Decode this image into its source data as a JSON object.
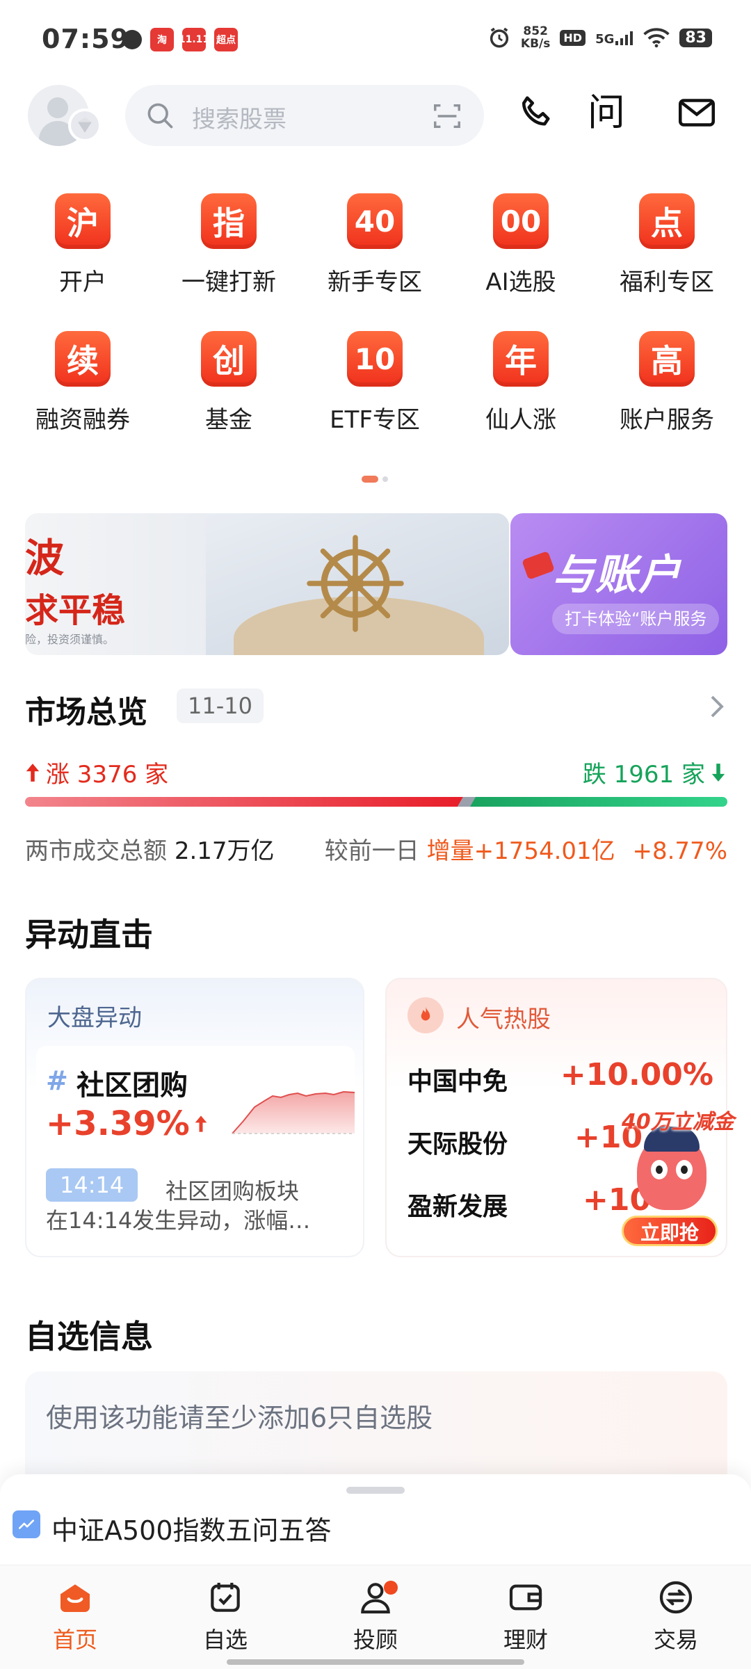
{
  "status_bar": {
    "time": "07:59",
    "apps": [
      "淘",
      "11.11",
      "超点"
    ],
    "net_speed_value": "852",
    "net_speed_unit": "KB/s",
    "hd": "HD",
    "signal": "5G",
    "battery": "83"
  },
  "header": {
    "search_placeholder": "搜索股票",
    "icons": [
      "phone-icon",
      "wen-icon",
      "mail-icon"
    ],
    "wen_glyph": "问"
  },
  "grid": [
    {
      "glyph": "沪",
      "label": "开户"
    },
    {
      "glyph": "指",
      "label": "一键打新"
    },
    {
      "glyph": "40",
      "label": "新手专区"
    },
    {
      "glyph": "00",
      "label": "AI选股"
    },
    {
      "glyph": "点",
      "label": "福利专区"
    },
    {
      "glyph": "续",
      "label": "融资融券"
    },
    {
      "glyph": "创",
      "label": "基金"
    },
    {
      "glyph": "10",
      "label": "ETF专区"
    },
    {
      "glyph": "年",
      "label": "仙人涨"
    },
    {
      "glyph": "高",
      "label": "账户服务"
    }
  ],
  "banners": {
    "b1_line1": "波",
    "b1_line2": "求平稳",
    "b1_line3": "险，投资须谨慎。",
    "b2_title": "与账户",
    "b2_sub": "打卡体验“账户服务"
  },
  "market": {
    "title": "市场总览",
    "date": "11-10",
    "up_label": "涨 3376 家",
    "down_label": "跌 1961 家",
    "up_count": 3376,
    "down_count": 1961,
    "turnover_label": "两市成交总额",
    "turnover_value": "2.17万亿",
    "compare_label": "较前一日",
    "compare_value": "增量+1754.01亿",
    "compare_pct": "+8.77%"
  },
  "anomaly": {
    "title": "异动直击",
    "left_card": {
      "title": "大盘异动",
      "hash": "#",
      "sector": "社区团购",
      "pct": "+3.39%",
      "time": "14:14",
      "desc1": "社区团购板块",
      "desc2": "在14:14发生异动，涨幅…"
    },
    "right_card": {
      "title": "人气热股",
      "stocks": [
        {
          "name": "中国中免",
          "pct": "+10.00%"
        },
        {
          "name": "天际股份",
          "pct": "+10.0"
        },
        {
          "name": "盈新发展",
          "pct": "+10"
        }
      ]
    },
    "promo": {
      "tag": "40万立减金",
      "button": "立即抢"
    }
  },
  "watchlist": {
    "title": "自选信息",
    "message": "使用该功能请至少添加6只自选股"
  },
  "sheet": {
    "text": "中证A500指数五问五答"
  },
  "bottom_nav": [
    {
      "label": "首页",
      "icon": "home-icon",
      "active": true
    },
    {
      "label": "自选",
      "icon": "watchlist-icon",
      "active": false
    },
    {
      "label": "投顾",
      "icon": "advisor-icon",
      "active": false,
      "dot": true
    },
    {
      "label": "理财",
      "icon": "wallet-icon",
      "active": false
    },
    {
      "label": "交易",
      "icon": "trade-icon",
      "active": false
    }
  ],
  "colors": {
    "accent": "#ef5a1d",
    "up": "#e32a1c",
    "down": "#16a35a"
  }
}
